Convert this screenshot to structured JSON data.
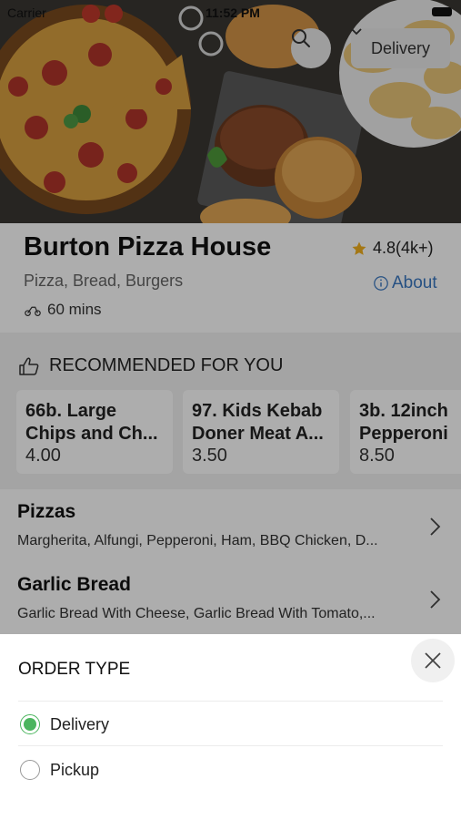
{
  "status_bar": {
    "carrier": "Carrier",
    "time": "11:52 PM"
  },
  "header": {
    "delivery_selector": "Delivery"
  },
  "restaurant": {
    "name": "Burton Pizza House",
    "rating": "4.8(4k+)",
    "cuisine": "Pizza, Bread, Burgers",
    "about_label": "About",
    "eta": "60 mins"
  },
  "recommended": {
    "title": "RECOMMENDED FOR YOU",
    "items": [
      {
        "name": "66b. Large Chips and Ch...",
        "price": "4.00"
      },
      {
        "name": "97. Kids Kebab Doner Meat A...",
        "price": "3.50"
      },
      {
        "name": "3b. 12inch Pepperoni",
        "price": "8.50"
      }
    ]
  },
  "categories": [
    {
      "title": "Pizzas",
      "subtitle": "Margherita, Alfungi, Pepperoni, Ham, BBQ Chicken, D..."
    },
    {
      "title": "Garlic Bread",
      "subtitle": "Garlic Bread With Cheese, Garlic Bread With Tomato,..."
    }
  ],
  "order_type_sheet": {
    "title": "ORDER TYPE",
    "selected": "Delivery",
    "options": [
      {
        "label": "Delivery",
        "selected": true
      },
      {
        "label": "Pickup",
        "selected": false
      }
    ]
  },
  "colors": {
    "accent_green": "#4bb55e",
    "link_blue": "#3a78c2",
    "star": "#f2b01e"
  }
}
